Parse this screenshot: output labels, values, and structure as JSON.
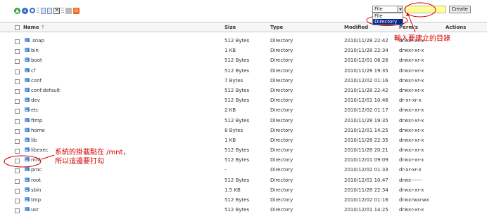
{
  "toolbar": {
    "icons": [
      "go-up-icon",
      "home-icon",
      "search-icon",
      "separator-dots-icon",
      "new-file-icon",
      "upload-icon",
      "delete-icon",
      "separator-dots-icon",
      "edit-icon",
      "admin-icon"
    ]
  },
  "create": {
    "type_selected": "File",
    "type_options": [
      "File",
      "Directory"
    ],
    "highlighted_option": "Directory",
    "name_value": "",
    "button_label": "Create"
  },
  "columns": {
    "name": "Name",
    "sort_indicator": "↑",
    "size": "Size",
    "type": "Type",
    "modified": "Modified",
    "perms": "Perm's",
    "actions": "Actions"
  },
  "rows": [
    {
      "name": ".snap",
      "size": "512 Bytes",
      "type": "Directory",
      "modified": "2010/11/28 22:42",
      "perms": "drwxr-xr-x"
    },
    {
      "name": "bin",
      "size": "1 KB",
      "type": "Directory",
      "modified": "2010/11/28 22:34",
      "perms": "drwxr-xr-x"
    },
    {
      "name": "boot",
      "size": "512 Bytes",
      "type": "Directory",
      "modified": "2010/12/01 06:26",
      "perms": "drwxr-xr-x"
    },
    {
      "name": "cf",
      "size": "512 Bytes",
      "type": "Directory",
      "modified": "2010/11/28 19:35",
      "perms": "drwxr-xr-x"
    },
    {
      "name": "conf",
      "size": "7 Bytes",
      "type": "Directory",
      "modified": "2010/12/02 01:16",
      "perms": "drwxr-xr-x"
    },
    {
      "name": "conf.default",
      "size": "512 Bytes",
      "type": "Directory",
      "modified": "2010/11/28 22:42",
      "perms": "drwxr-xr-x"
    },
    {
      "name": "dev",
      "size": "512 Bytes",
      "type": "Directory",
      "modified": "2010/12/01 10:46",
      "perms": "dr-xr-xr-x"
    },
    {
      "name": "etc",
      "size": "2 KB",
      "type": "Directory",
      "modified": "2010/12/02 01:17",
      "perms": "drwxr-xr-x"
    },
    {
      "name": "ftmp",
      "size": "512 Bytes",
      "type": "Directory",
      "modified": "2010/11/28 19:35",
      "perms": "drwxr-xr-x"
    },
    {
      "name": "home",
      "size": "8 Bytes",
      "type": "Directory",
      "modified": "2010/12/01 14:25",
      "perms": "drwxr-xr-x"
    },
    {
      "name": "lib",
      "size": "1 KB",
      "type": "Directory",
      "modified": "2010/11/28 22:35",
      "perms": "drwxr-xr-x"
    },
    {
      "name": "libexec",
      "size": "512 Bytes",
      "type": "Directory",
      "modified": "2010/11/28 20:21",
      "perms": "drwxr-xr-x"
    },
    {
      "name": "mnt",
      "size": "512 Bytes",
      "type": "Directory",
      "modified": "2010/12/01 09:09",
      "perms": "drwxr-xr-x"
    },
    {
      "name": "proc",
      "size": "-",
      "type": "Directory",
      "modified": "2010/12/02 01:33",
      "perms": "dr-xr-xr-x"
    },
    {
      "name": "root",
      "size": "512 Bytes",
      "type": "Directory",
      "modified": "2010/12/01 10:47",
      "perms": "drwx------"
    },
    {
      "name": "sbin",
      "size": "1.5 KB",
      "type": "Directory",
      "modified": "2010/11/28 22:34",
      "perms": "drwxr-xr-x"
    },
    {
      "name": "tmp",
      "size": "512 Bytes",
      "type": "Directory",
      "modified": "2010/12/02 01:16",
      "perms": "drwxrwxrwx"
    },
    {
      "name": "usr",
      "size": "512 Bytes",
      "type": "Directory",
      "modified": "2010/12/01 14:25",
      "perms": "drwxr-xr-x"
    }
  ],
  "annotations": {
    "create_note": "輸入要建立的目錄",
    "mount_note_line1": "系統的掛載點在 /mnt，",
    "mount_note_line2": "所以這邊要打勾",
    "color": "#d40000"
  }
}
